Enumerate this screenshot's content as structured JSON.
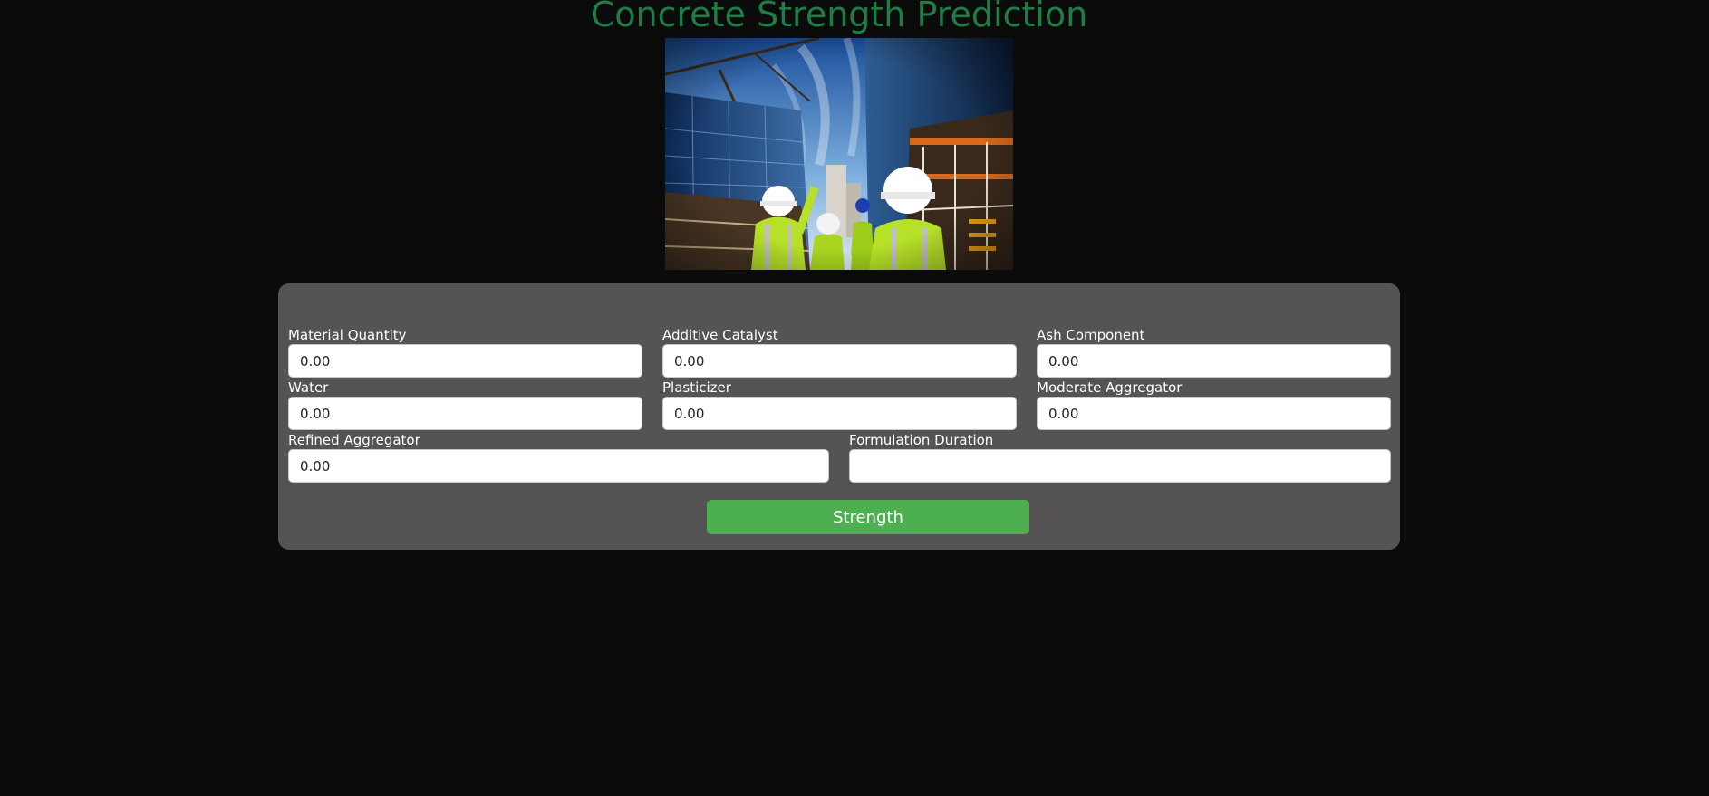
{
  "page": {
    "title": "Concrete Strength Prediction",
    "background_color": "#0b0b0b",
    "title_color": "#1e7d45",
    "panel_color": "#555353",
    "button_color": "#4caf50"
  },
  "hero_image": {
    "icon": "construction-site-photo"
  },
  "form": {
    "fields": [
      {
        "label": "Material Quantity",
        "placeholder": "0.00"
      },
      {
        "label": "Additive Catalyst",
        "placeholder": "0.00"
      },
      {
        "label": "Ash Component",
        "placeholder": "0.00"
      },
      {
        "label": "Water",
        "placeholder": "0.00"
      },
      {
        "label": "Plasticizer",
        "placeholder": "0.00"
      },
      {
        "label": "Moderate Aggregator",
        "placeholder": "0.00"
      },
      {
        "label": "Refined Aggregator",
        "placeholder": "0.00"
      },
      {
        "label": "Formulation Duration",
        "placeholder": ""
      }
    ],
    "submit_label": "Strength"
  }
}
